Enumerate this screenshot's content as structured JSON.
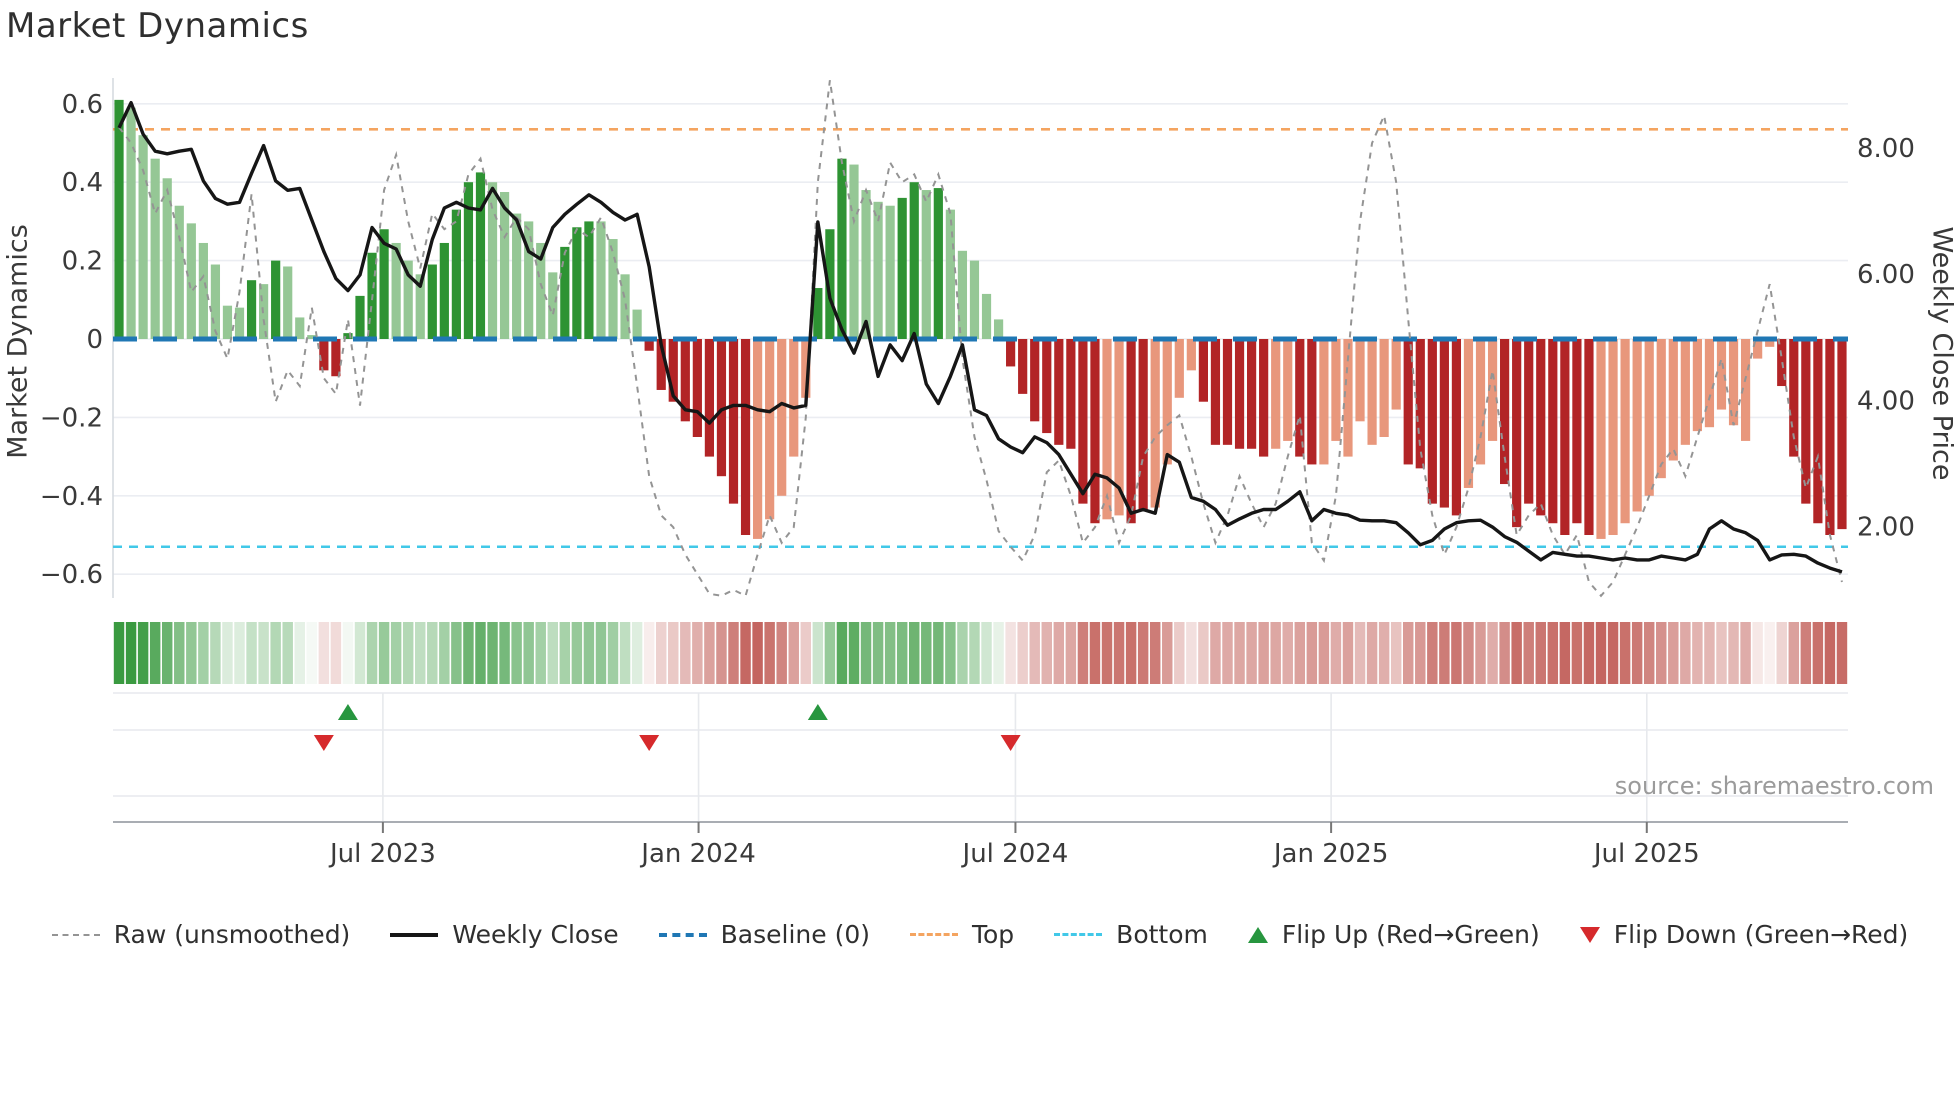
{
  "title": "Market Dynamics",
  "source": "source: sharemaestro.com",
  "colors": {
    "bar_strong_green": "#2e9333",
    "bar_soft_green": "#95c795",
    "bar_strong_red": "#b22426",
    "bar_soft_red": "#e8977c",
    "baseline_blue": "#1f77b4",
    "top_orange": "#f4a460",
    "bottom_cyan": "#41c8e8",
    "raw_gray": "#949494",
    "close_black": "#161616",
    "grid": "#ebedf2",
    "spine": "#d6dae0",
    "panel_axis": "#a9adb3",
    "tick_text": "#3a3a3a",
    "flip_up_green": "#27963f",
    "flip_down_red": "#d62a2c"
  },
  "legend": {
    "items": [
      {
        "label": "Raw (unsmoothed)",
        "swatch": "dash-gray"
      },
      {
        "label": "Weekly Close",
        "swatch": "solid-black"
      },
      {
        "label": "Baseline (0)",
        "swatch": "dash-blue"
      },
      {
        "label": "Top",
        "swatch": "dot-orange"
      },
      {
        "label": "Bottom",
        "swatch": "dot-cyan"
      },
      {
        "label": "Flip Up (Red→Green)",
        "swatch": "tri-up"
      },
      {
        "label": "Flip Down (Green→Red)",
        "swatch": "tri-down"
      }
    ]
  },
  "chart_data": {
    "type": "combo",
    "title": "Market Dynamics",
    "x_unit": "weekly",
    "left_axis": {
      "label": "Market Dynamics",
      "tick_labels": [
        "0.6",
        "0.4",
        "0.2",
        "0",
        "−0.2",
        "−0.4",
        "−0.6"
      ],
      "tick_values": [
        0.6,
        0.4,
        0.2,
        0,
        -0.2,
        -0.4,
        -0.6
      ],
      "range": [
        -0.72,
        0.67
      ],
      "grid": true
    },
    "right_axis": {
      "label": "Weekly Close Price",
      "tick_labels": [
        "8.00",
        "6.00",
        "4.00",
        "2.00"
      ],
      "tick_values": [
        8.0,
        6.0,
        4.0,
        2.0
      ],
      "range": [
        1.15,
        8.95
      ]
    },
    "x_ticks": [
      {
        "label": "Jul 2023",
        "week": 22.4
      },
      {
        "label": "Jan 2024",
        "week": 48.6
      },
      {
        "label": "Jul 2024",
        "week": 74.9
      },
      {
        "label": "Jan 2025",
        "week": 101.1
      },
      {
        "label": "Jul 2025",
        "week": 127.3
      }
    ],
    "reference_lines": {
      "baseline": 0.0,
      "top": 0.535,
      "bottom": -0.53
    },
    "flip_up_weeks": [
      19,
      58
    ],
    "flip_down_weeks": [
      17,
      44,
      74
    ],
    "series": [
      {
        "name": "Market Dynamics",
        "type": "bar",
        "axis": "left",
        "values": [
          0.61,
          0.59,
          0.52,
          0.46,
          0.41,
          0.34,
          0.295,
          0.245,
          0.19,
          0.085,
          0.08,
          0.15,
          0.14,
          0.2,
          0.185,
          0.055,
          0.01,
          -0.08,
          -0.095,
          0.015,
          0.11,
          0.22,
          0.28,
          0.245,
          0.2,
          0.165,
          0.19,
          0.245,
          0.33,
          0.4,
          0.425,
          0.4,
          0.375,
          0.32,
          0.3,
          0.245,
          0.17,
          0.235,
          0.285,
          0.3,
          0.3,
          0.255,
          0.165,
          0.075,
          -0.03,
          -0.13,
          -0.16,
          -0.21,
          -0.25,
          -0.3,
          -0.35,
          -0.42,
          -0.5,
          -0.51,
          -0.46,
          -0.4,
          -0.3,
          -0.15,
          0.13,
          0.28,
          0.46,
          0.445,
          0.38,
          0.35,
          0.34,
          0.36,
          0.4,
          0.38,
          0.385,
          0.33,
          0.225,
          0.2,
          0.115,
          0.05,
          -0.07,
          -0.14,
          -0.21,
          -0.24,
          -0.27,
          -0.28,
          -0.42,
          -0.47,
          -0.46,
          -0.45,
          -0.47,
          -0.44,
          -0.43,
          -0.32,
          -0.15,
          -0.08,
          -0.16,
          -0.27,
          -0.27,
          -0.28,
          -0.28,
          -0.3,
          -0.28,
          -0.26,
          -0.3,
          -0.32,
          -0.32,
          -0.26,
          -0.3,
          -0.21,
          -0.27,
          -0.25,
          -0.18,
          -0.32,
          -0.33,
          -0.42,
          -0.43,
          -0.45,
          -0.38,
          -0.32,
          -0.26,
          -0.37,
          -0.48,
          -0.42,
          -0.45,
          -0.47,
          -0.5,
          -0.47,
          -0.5,
          -0.51,
          -0.5,
          -0.47,
          -0.44,
          -0.4,
          -0.355,
          -0.31,
          -0.27,
          -0.235,
          -0.225,
          -0.18,
          -0.22,
          -0.26,
          -0.05,
          -0.02,
          -0.12,
          -0.3,
          -0.42,
          -0.47,
          -0.5,
          -0.485
        ],
        "strong_shade": [
          1,
          0,
          0,
          0,
          0,
          0,
          0,
          0,
          0,
          0,
          0,
          1,
          0,
          1,
          0,
          0,
          0,
          1,
          1,
          1,
          1,
          1,
          1,
          0,
          0,
          0,
          1,
          1,
          1,
          1,
          1,
          0,
          0,
          0,
          0,
          0,
          0,
          1,
          1,
          1,
          0,
          0,
          0,
          0,
          1,
          1,
          1,
          1,
          1,
          1,
          1,
          1,
          1,
          0,
          0,
          0,
          0,
          0,
          1,
          1,
          1,
          0,
          0,
          0,
          0,
          1,
          1,
          0,
          1,
          0,
          0,
          0,
          0,
          0,
          1,
          1,
          1,
          1,
          1,
          1,
          1,
          1,
          0,
          0,
          1,
          1,
          0,
          0,
          0,
          0,
          1,
          1,
          1,
          1,
          1,
          1,
          0,
          0,
          1,
          1,
          0,
          0,
          0,
          0,
          0,
          0,
          0,
          1,
          1,
          1,
          1,
          1,
          0,
          0,
          0,
          1,
          1,
          1,
          1,
          1,
          1,
          1,
          1,
          0,
          0,
          0,
          0,
          0,
          0,
          0,
          0,
          0,
          0,
          0,
          0,
          0,
          0,
          0,
          1,
          1,
          1,
          1,
          1,
          1
        ]
      },
      {
        "name": "Raw (unsmoothed)",
        "type": "line",
        "style": "dashed",
        "axis": "left",
        "values": [
          0.54,
          0.5,
          0.43,
          0.32,
          0.38,
          0.26,
          0.12,
          0.16,
          0.02,
          -0.05,
          0.12,
          0.37,
          0.05,
          -0.16,
          -0.08,
          -0.12,
          0.08,
          -0.1,
          -0.14,
          0.05,
          -0.17,
          0.1,
          0.38,
          0.47,
          0.3,
          0.18,
          0.32,
          0.28,
          0.3,
          0.42,
          0.46,
          0.33,
          0.26,
          0.31,
          0.28,
          0.14,
          0.06,
          0.22,
          0.28,
          0.26,
          0.31,
          0.22,
          0.1,
          -0.12,
          -0.35,
          -0.45,
          -0.48,
          -0.55,
          -0.6,
          -0.65,
          -0.68,
          -0.64,
          -0.66,
          -0.55,
          -0.45,
          -0.52,
          -0.48,
          -0.2,
          0.4,
          0.66,
          0.45,
          0.3,
          0.38,
          0.3,
          0.45,
          0.4,
          0.42,
          0.35,
          0.42,
          0.32,
          -0.05,
          -0.25,
          -0.36,
          -0.49,
          -0.53,
          -0.565,
          -0.5,
          -0.34,
          -0.31,
          -0.4,
          -0.52,
          -0.48,
          -0.4,
          -0.52,
          -0.45,
          -0.3,
          -0.25,
          -0.22,
          -0.195,
          -0.3,
          -0.42,
          -0.52,
          -0.45,
          -0.35,
          -0.42,
          -0.48,
          -0.42,
          -0.3,
          -0.195,
          -0.52,
          -0.565,
          -0.4,
          -0.05,
          0.3,
          0.5,
          0.57,
          0.4,
          0.05,
          -0.28,
          -0.45,
          -0.55,
          -0.48,
          -0.38,
          -0.25,
          -0.08,
          -0.3,
          -0.5,
          -0.45,
          -0.42,
          -0.5,
          -0.55,
          -0.5,
          -0.62,
          -0.7,
          -0.62,
          -0.55,
          -0.48,
          -0.4,
          -0.32,
          -0.28,
          -0.35,
          -0.25,
          -0.15,
          -0.05,
          -0.22,
          -0.1,
          0.02,
          0.14,
          -0.05,
          -0.25,
          -0.38,
          -0.3,
          -0.5,
          -0.62
        ]
      },
      {
        "name": "Weekly Close",
        "type": "line",
        "axis": "right",
        "values": [
          8.32,
          8.72,
          8.22,
          7.95,
          7.91,
          7.95,
          7.98,
          7.48,
          7.2,
          7.11,
          7.14,
          7.6,
          8.04,
          7.48,
          7.33,
          7.36,
          6.86,
          6.36,
          5.93,
          5.74,
          5.99,
          6.74,
          6.49,
          6.4,
          5.99,
          5.81,
          6.55,
          7.05,
          7.14,
          7.05,
          7.02,
          7.36,
          7.05,
          6.86,
          6.36,
          6.24,
          6.74,
          6.95,
          7.11,
          7.26,
          7.14,
          6.98,
          6.86,
          6.95,
          6.12,
          4.88,
          4.07,
          3.85,
          3.82,
          3.64,
          3.85,
          3.92,
          3.92,
          3.85,
          3.82,
          3.95,
          3.88,
          3.92,
          6.83,
          5.62,
          5.12,
          4.75,
          5.25,
          4.38,
          4.88,
          4.63,
          5.06,
          4.26,
          3.95,
          4.38,
          4.88,
          3.85,
          3.76,
          3.39,
          3.26,
          3.17,
          3.42,
          3.33,
          3.14,
          2.83,
          2.52,
          2.83,
          2.77,
          2.61,
          2.21,
          2.27,
          2.21,
          3.14,
          3.02,
          2.46,
          2.4,
          2.27,
          2.02,
          2.12,
          2.21,
          2.27,
          2.27,
          2.4,
          2.55,
          2.09,
          2.27,
          2.21,
          2.18,
          2.1,
          2.09,
          2.09,
          2.06,
          1.9,
          1.71,
          1.78,
          1.96,
          2.06,
          2.09,
          2.1,
          1.99,
          1.84,
          1.75,
          1.61,
          1.47,
          1.59,
          1.56,
          1.53,
          1.53,
          1.5,
          1.47,
          1.5,
          1.47,
          1.47,
          1.53,
          1.5,
          1.47,
          1.56,
          1.96,
          2.09,
          1.96,
          1.9,
          1.78,
          1.47,
          1.55,
          1.56,
          1.53,
          1.42,
          1.34,
          1.28
        ]
      }
    ],
    "heatmap": {
      "note": "strip mirrors bar values, green positive / red negative, intensity by magnitude"
    }
  }
}
